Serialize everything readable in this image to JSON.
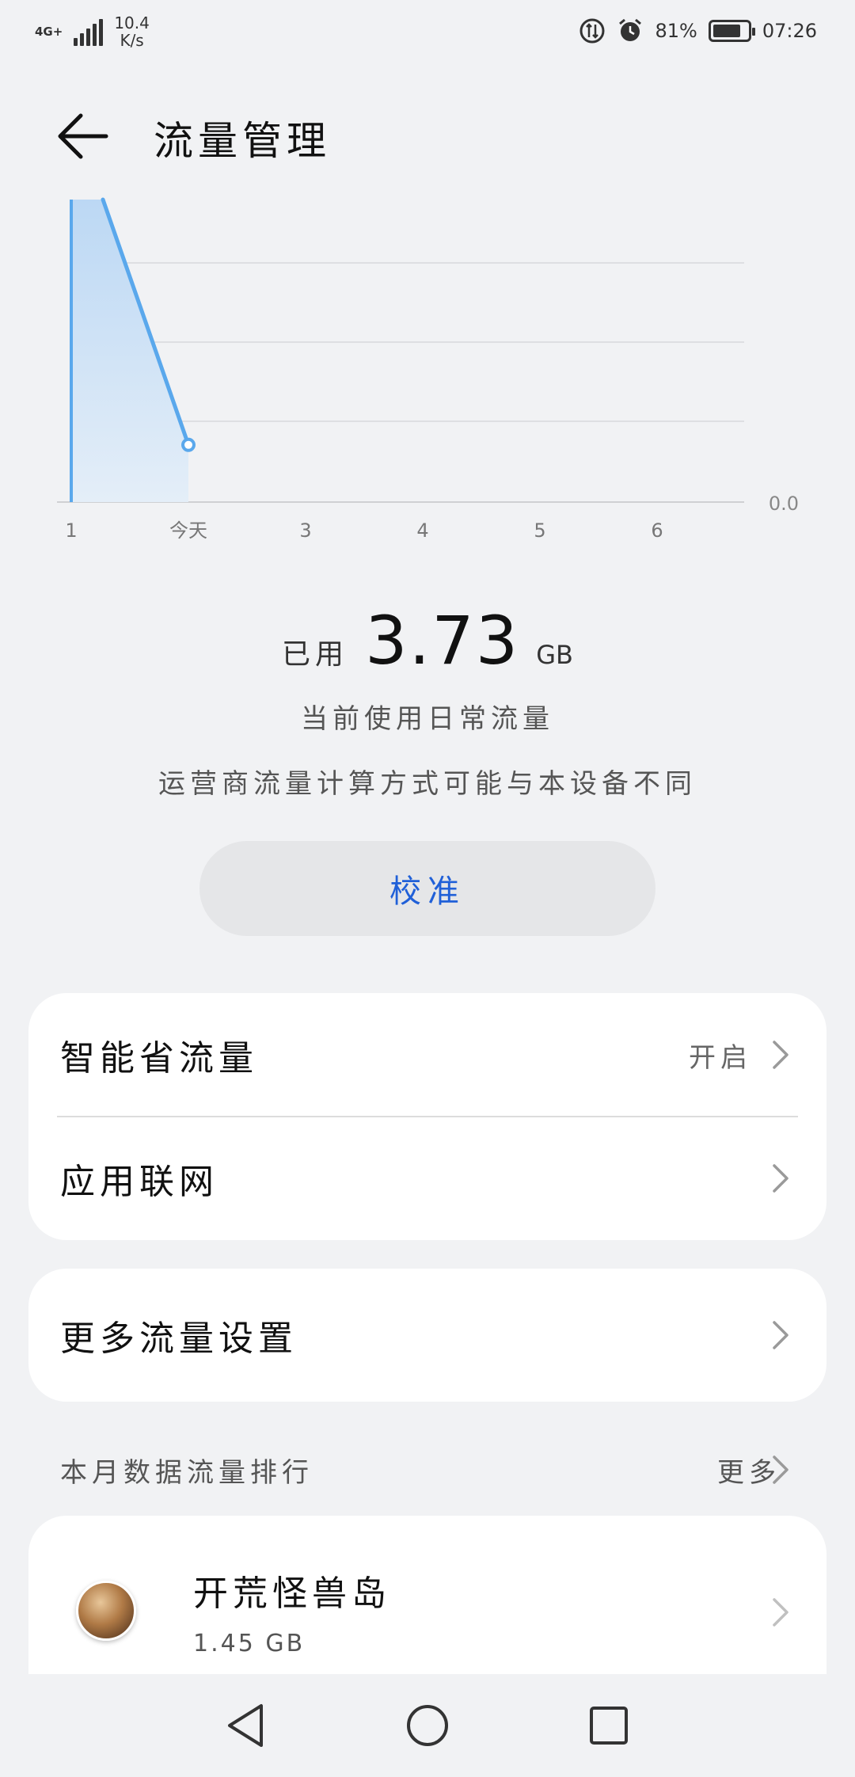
{
  "status_bar": {
    "network": "4G+",
    "speed_value": "10.4",
    "speed_unit": "K/s",
    "battery_percent": "81%",
    "battery_level": 0.81,
    "time": "07:26"
  },
  "header": {
    "title": "流量管理"
  },
  "chart_data": {
    "type": "area",
    "x_tick_labels": [
      "1",
      "今天",
      "3",
      "4",
      "5",
      "6"
    ],
    "y_axis_label": "0.0",
    "series": [
      {
        "x": [
          "1",
          "今天"
        ],
        "values": [
          1.0,
          0.18
        ]
      }
    ],
    "y_scale": "relative",
    "grid": true,
    "colors": {
      "line": "#5aa8ec",
      "fill": "#cfe3f7"
    }
  },
  "usage": {
    "used_label": "已用",
    "used_value": "3.73",
    "used_unit": "GB",
    "current_plan": "当前使用日常流量",
    "note": "运营商流量计算方式可能与本设备不同"
  },
  "calibrate_button": "校准",
  "settings_card": {
    "smart_save_label": "智能省流量",
    "smart_save_value": "开启",
    "app_network_label": "应用联网"
  },
  "more_card": {
    "more_settings_label": "更多流量设置"
  },
  "ranking": {
    "title": "本月数据流量排行",
    "more": "更多",
    "apps": [
      {
        "name": "开荒怪兽岛",
        "usage": "1.45 GB"
      }
    ]
  },
  "colors": {
    "accent": "#2060d8",
    "background": "#f1f2f4",
    "card": "#ffffff"
  }
}
